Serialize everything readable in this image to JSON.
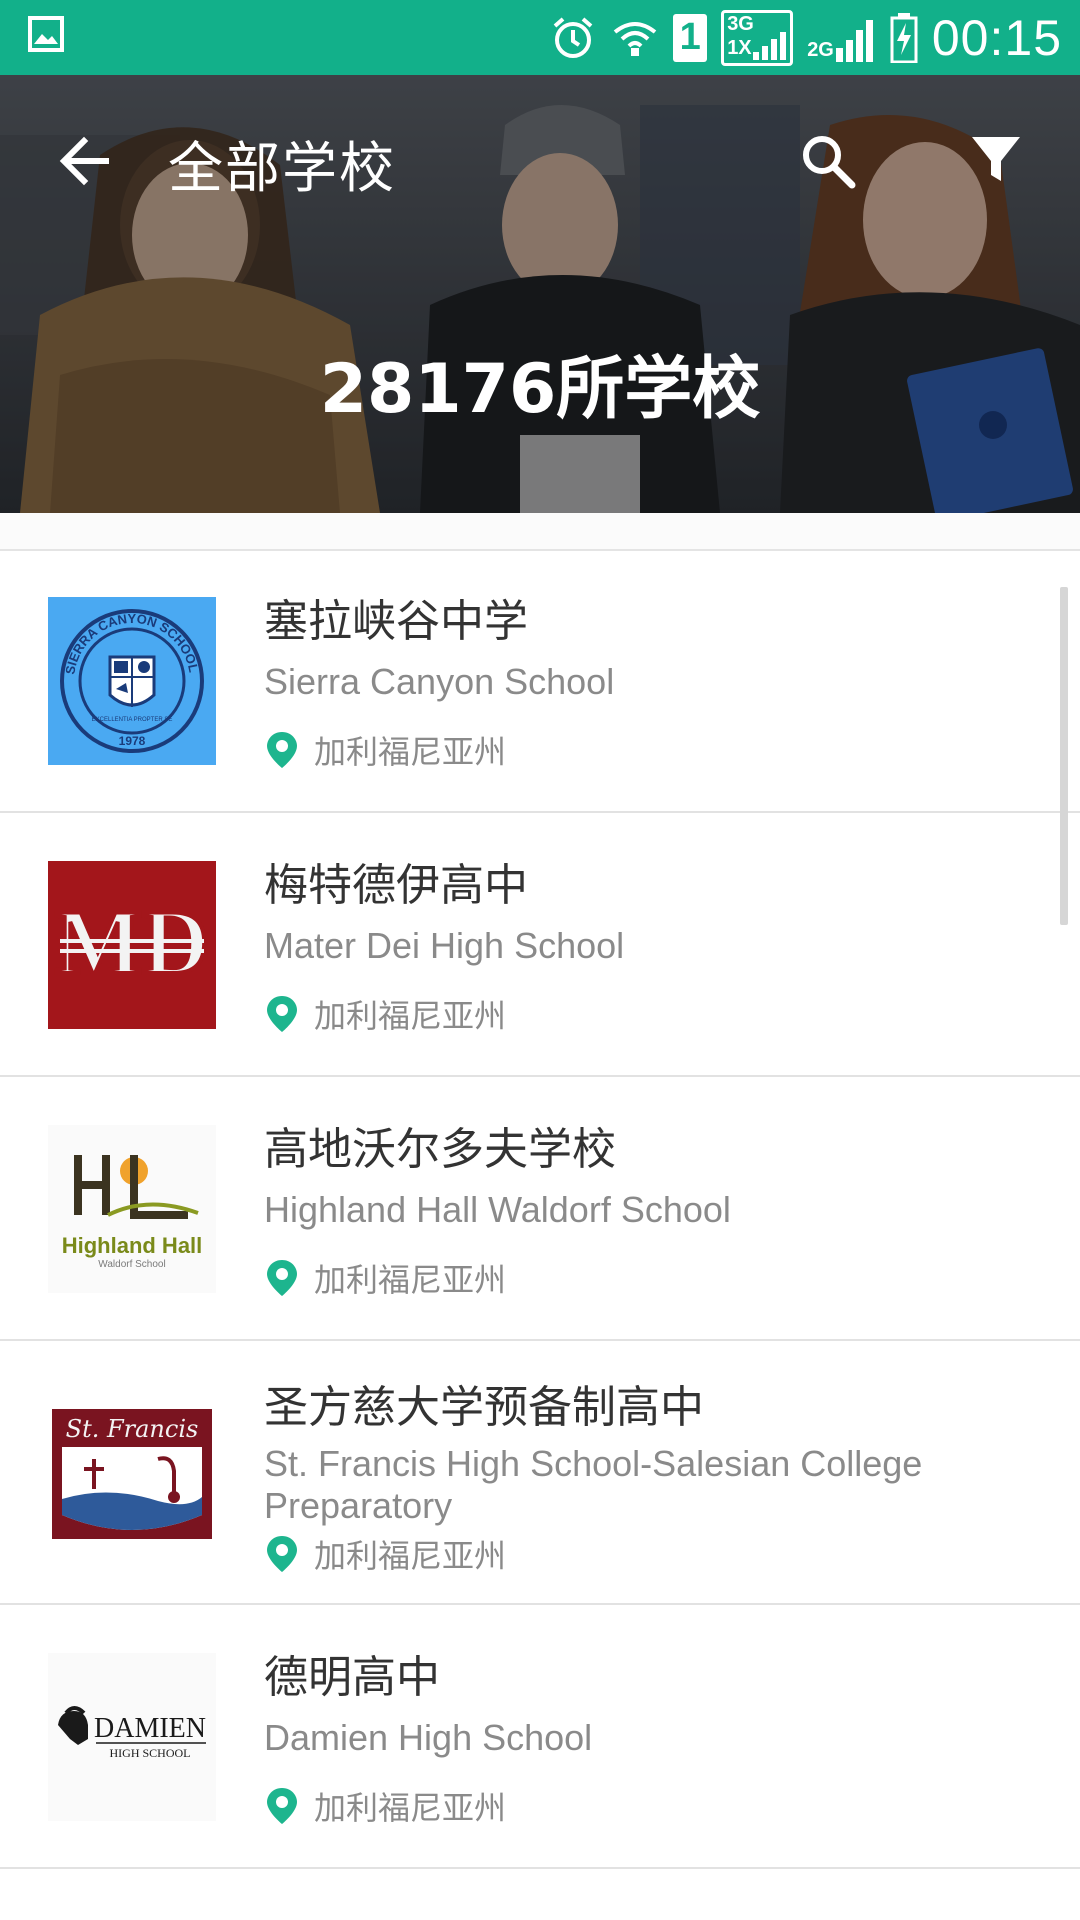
{
  "status_bar": {
    "time": "00:15",
    "sim_slot": "1",
    "network_3g": "3G",
    "network_1x": "1X",
    "network_2g": "2G",
    "icons": [
      "image-icon",
      "alarm-icon",
      "wifi-icon",
      "sim-icon",
      "signal-3g-icon",
      "signal-2g-icon",
      "battery-charging-icon"
    ]
  },
  "header": {
    "title": "全部学校",
    "count_text": "28176所学校",
    "icons": [
      "back-arrow-icon",
      "search-icon",
      "filter-icon"
    ]
  },
  "colors": {
    "accent": "#12b08a",
    "pin": "#1db58e",
    "text_primary": "#333333",
    "text_secondary": "#8a8a8a"
  },
  "schools": [
    {
      "name_cn": "塞拉峡谷中学",
      "name_en": "Sierra Canyon School",
      "location": "加利福尼亚州",
      "logo": "sierra-canyon-seal",
      "logo_text": "SIERRA CANYON SCHOOL",
      "logo_motto": "EXCELLENTIA PROPTER SE",
      "logo_year": "1978"
    },
    {
      "name_cn": "梅特德伊高中",
      "name_en": "Mater Dei High School",
      "location": "加利福尼亚州",
      "logo": "mater-dei-md-monogram",
      "logo_text": "MD"
    },
    {
      "name_cn": "高地沃尔多夫学校",
      "name_en": "Highland Hall Waldorf School",
      "location": "加利福尼亚州",
      "logo": "highland-hall-logo",
      "logo_text": "Highland Hall",
      "logo_sub": "Waldorf School"
    },
    {
      "name_cn": "圣方慈大学预备制高中",
      "name_en": "St. Francis High School-Salesian College Preparatory",
      "location": "加利福尼亚州",
      "logo": "st-francis-crest",
      "logo_text": "St. Francis"
    },
    {
      "name_cn": "德明高中",
      "name_en": "Damien High School",
      "location": "加利福尼亚州",
      "logo": "damien-spartan-logo",
      "logo_text": "DAMIEN",
      "logo_sub": "HIGH SCHOOL"
    }
  ]
}
